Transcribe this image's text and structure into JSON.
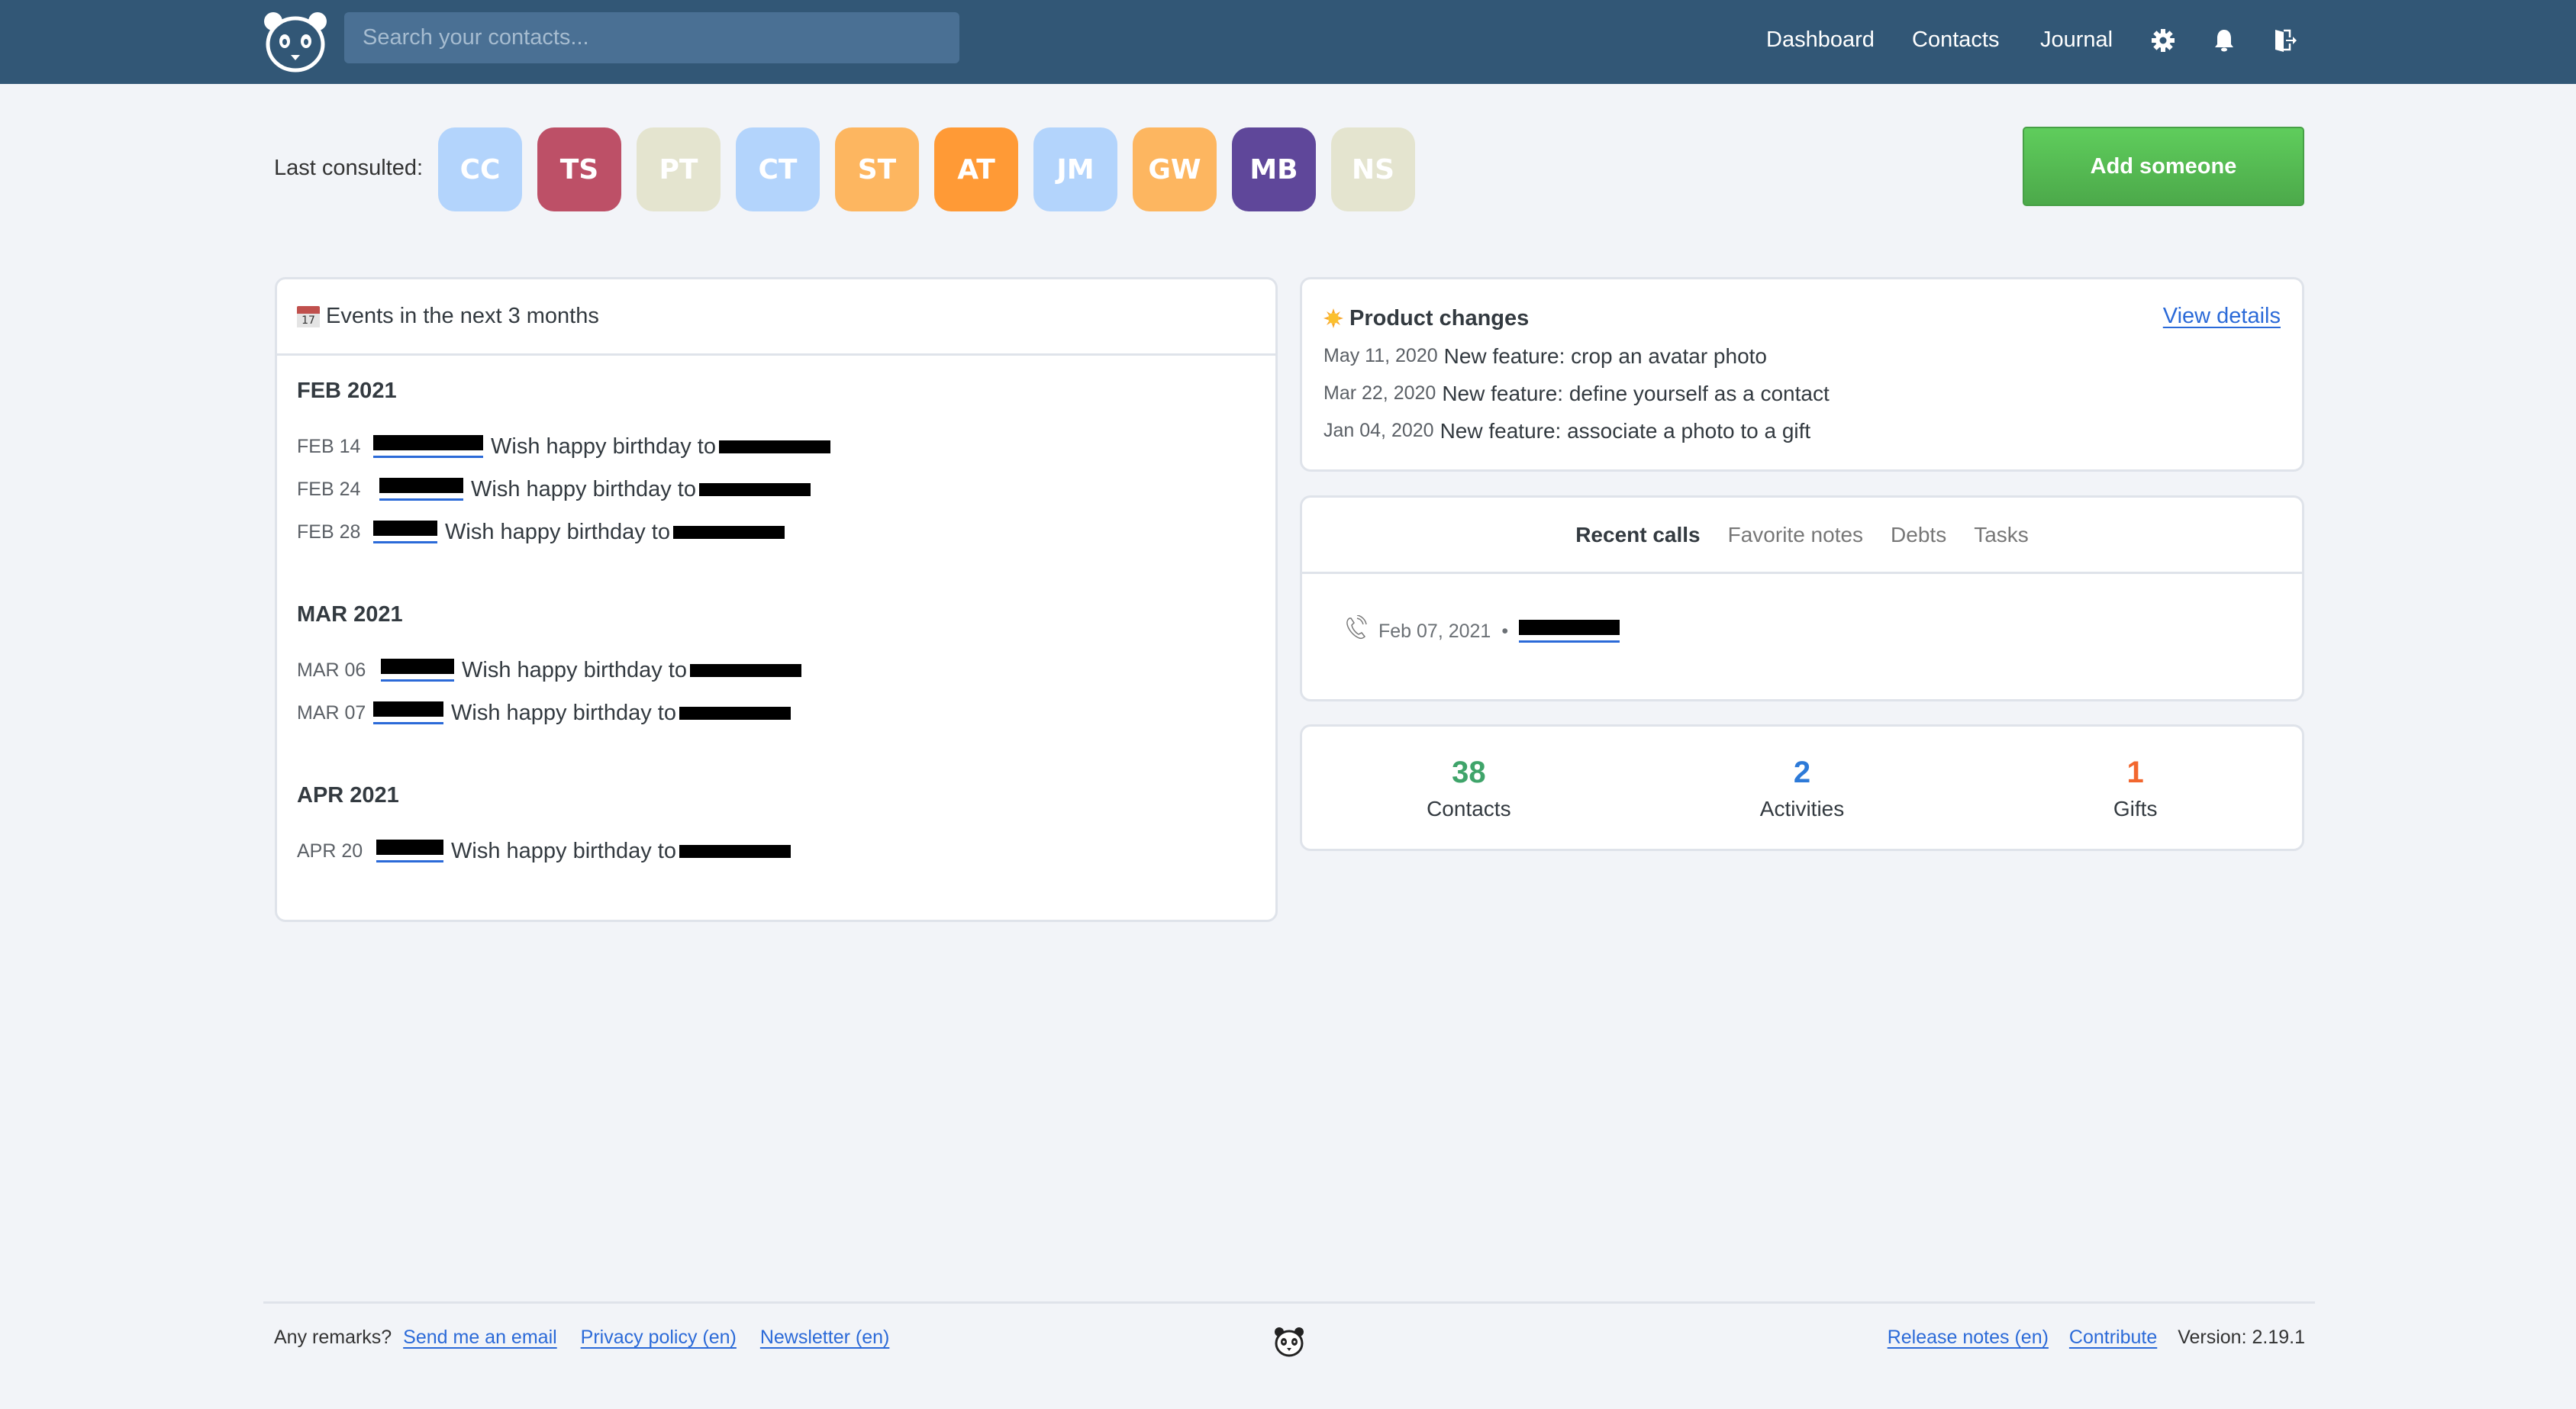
{
  "header": {
    "search_placeholder": "Search your contacts...",
    "nav": [
      {
        "label": "Dashboard"
      },
      {
        "label": "Contacts"
      },
      {
        "label": "Journal"
      }
    ],
    "icons": [
      "settings-gear-icon",
      "notifications-bell-icon",
      "logout-door-icon"
    ]
  },
  "last_consulted": {
    "label": "Last consulted:",
    "avatars": [
      {
        "initials": "CC",
        "color": "#b3d4fc"
      },
      {
        "initials": "TS",
        "color": "#bd5067"
      },
      {
        "initials": "PT",
        "color": "#e4e4cf"
      },
      {
        "initials": "CT",
        "color": "#b3d4fc"
      },
      {
        "initials": "ST",
        "color": "#fdb660"
      },
      {
        "initials": "AT",
        "color": "#ff9a36"
      },
      {
        "initials": "JM",
        "color": "#b3d4fc"
      },
      {
        "initials": "GW",
        "color": "#fdb660"
      },
      {
        "initials": "MB",
        "color": "#5f479a"
      },
      {
        "initials": "NS",
        "color": "#e4e4cf"
      }
    ]
  },
  "add_button": {
    "label": "Add someone"
  },
  "events": {
    "title": "Events in the next 3 months",
    "calendar_icon_day": "17",
    "months": [
      {
        "label": "FEB 2021",
        "items": [
          {
            "date": "FEB 14",
            "text": "Wish happy birthday to",
            "contact": "[redacted]"
          },
          {
            "date": "FEB 24",
            "text": "Wish happy birthday to",
            "contact": "[redacted]"
          },
          {
            "date": "FEB 28",
            "text": "Wish happy birthday to",
            "contact": "[redacted]"
          }
        ]
      },
      {
        "label": "MAR 2021",
        "items": [
          {
            "date": "MAR 06",
            "text": "Wish happy birthday to",
            "contact": "[redacted]"
          },
          {
            "date": "MAR 07",
            "text": "Wish happy birthday to",
            "contact": "[redacted]"
          }
        ]
      },
      {
        "label": "APR 2021",
        "items": [
          {
            "date": "APR 20",
            "text": "Wish happy birthday to",
            "contact": "[redacted]"
          }
        ]
      }
    ]
  },
  "product_changes": {
    "title": "Product changes",
    "view_details": "View details",
    "items": [
      {
        "date": "May 11, 2020",
        "text": "New feature: crop an avatar photo"
      },
      {
        "date": "Mar 22, 2020",
        "text": "New feature: define yourself as a contact"
      },
      {
        "date": "Jan 04, 2020",
        "text": "New feature: associate a photo to a gift"
      }
    ]
  },
  "activity_tabs": {
    "tabs": [
      {
        "label": "Recent calls",
        "active": true
      },
      {
        "label": "Favorite notes",
        "active": false
      },
      {
        "label": "Debts",
        "active": false
      },
      {
        "label": "Tasks",
        "active": false
      }
    ],
    "calls": [
      {
        "date": "Feb 07, 2021",
        "bullet": "•",
        "contact": "[redacted]"
      }
    ]
  },
  "stats": [
    {
      "value": "38",
      "label": "Contacts",
      "color": "#3fa46a"
    },
    {
      "value": "2",
      "label": "Activities",
      "color": "#2d7ad8"
    },
    {
      "value": "1",
      "label": "Gifts",
      "color": "#f2672f"
    }
  ],
  "footer": {
    "remarks": "Any remarks?",
    "links_left": [
      "Send me an email",
      "Privacy policy (en)",
      "Newsletter (en)"
    ],
    "links_right": [
      "Release notes (en)",
      "Contribute"
    ],
    "version": "Version: 2.19.1"
  }
}
